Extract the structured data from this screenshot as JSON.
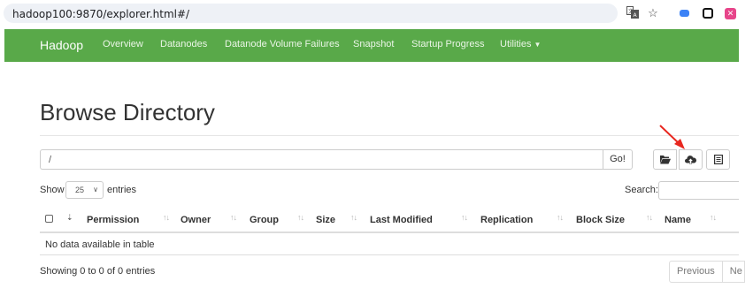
{
  "browser": {
    "url": "hadoop100:9870/explorer.html#/",
    "icons": [
      "translate-icon",
      "star-icon",
      "extension-icon",
      "extension-icon",
      "extension-icon"
    ]
  },
  "navbar": {
    "brand": "Hadoop",
    "links": [
      "Overview",
      "Datanodes",
      "Datanode Volume Failures",
      "Snapshot",
      "Startup Progress",
      "Utilities"
    ],
    "color": "#59a949"
  },
  "page": {
    "title": "Browse Directory",
    "path_value": "/",
    "go_label": "Go!"
  },
  "controls": {
    "show_label": "Show",
    "entries_value": "25",
    "entries_label": "entries",
    "search_label": "Search:"
  },
  "table": {
    "columns": [
      "Permission",
      "Owner",
      "Group",
      "Size",
      "Last Modified",
      "Replication",
      "Block Size",
      "Name"
    ],
    "empty_message": "No data available in table"
  },
  "footer": {
    "info": "Showing 0 to 0 of 0 entries",
    "previous_label": "Previous",
    "next_label": "Ne"
  },
  "annotation": {
    "arrow_color": "#e8271f",
    "target": "upload-button"
  }
}
